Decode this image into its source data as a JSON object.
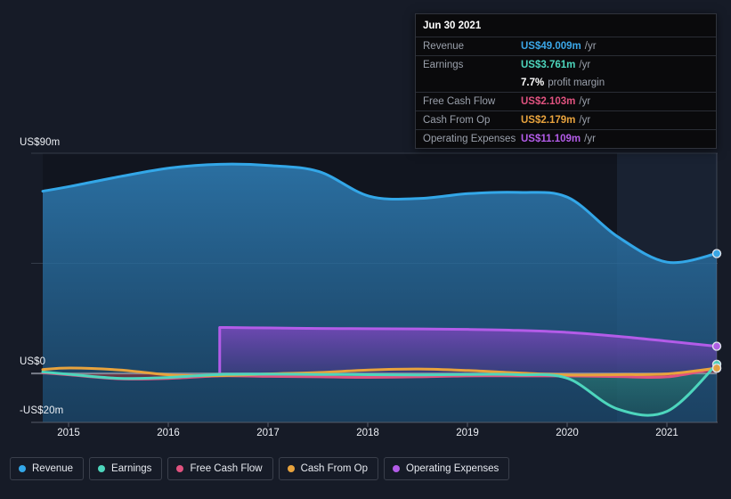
{
  "chart_data": {
    "type": "area",
    "title": "",
    "xlabel": "",
    "ylabel": "",
    "grid": true,
    "legend_position": "bottom",
    "ylim": [
      -20,
      90
    ],
    "y_ticks": [
      {
        "label": "US$90m",
        "value": 90
      },
      {
        "label": "US$0",
        "value": 0
      },
      {
        "label": "-US$20m",
        "value": -20
      }
    ],
    "x_ticks": [
      "2015",
      "2016",
      "2017",
      "2018",
      "2019",
      "2020",
      "2021"
    ],
    "x": [
      2014.72,
      2015,
      2015.5,
      2016,
      2016.5,
      2017,
      2017.5,
      2018,
      2018.5,
      2019,
      2019.5,
      2020,
      2020.5,
      2021,
      2021.5
    ],
    "series": [
      {
        "name": "Revenue",
        "color": "#33a7e8",
        "values": [
          74.5,
          76.5,
          80.5,
          84.0,
          85.5,
          85.0,
          82.5,
          72.5,
          71.5,
          73.5,
          74.0,
          72.0,
          56.0,
          45.5,
          49.009
        ]
      },
      {
        "name": "Earnings",
        "color": "#4dd6bd",
        "values": [
          0.6,
          -0.4,
          -2.0,
          -1.6,
          -0.4,
          -0.3,
          -0.4,
          -0.5,
          -0.6,
          -0.4,
          -0.5,
          -2.0,
          -14.5,
          -15.5,
          3.761
        ]
      },
      {
        "name": "Free Cash Flow",
        "color": "#e0527f",
        "values": [
          0.3,
          -0.6,
          -2.2,
          -2.0,
          -1.0,
          -1.2,
          -1.4,
          -1.6,
          -1.4,
          -1.0,
          -1.0,
          -1.0,
          -1.3,
          -1.4,
          2.103
        ]
      },
      {
        "name": "Cash From Op",
        "color": "#e8a33d",
        "values": [
          1.6,
          2.2,
          1.4,
          -0.6,
          -0.9,
          -0.2,
          0.4,
          1.4,
          1.8,
          1.2,
          0.2,
          -0.6,
          -0.5,
          -0.2,
          2.179
        ]
      },
      {
        "name": "Operating Expenses",
        "color": "#b35ce8",
        "start_x": 2016.5,
        "values": [
          null,
          null,
          null,
          null,
          18.8,
          18.6,
          18.4,
          18.3,
          18.2,
          18.0,
          17.6,
          16.8,
          15.2,
          13.2,
          11.109
        ]
      }
    ]
  },
  "tooltip": {
    "date": "Jun 30 2021",
    "rows": [
      {
        "label": "Revenue",
        "value": "US$49.009m",
        "unit": "/yr",
        "color": "#3ba7e8"
      },
      {
        "label": "Earnings",
        "value": "US$3.761m",
        "unit": "/yr",
        "color": "#4dd6bd"
      },
      {
        "label": "",
        "value": "7.7%",
        "unit": "profit margin",
        "color": "#ffffff",
        "sub": true
      },
      {
        "label": "Free Cash Flow",
        "value": "US$2.103m",
        "unit": "/yr",
        "color": "#e0527f"
      },
      {
        "label": "Cash From Op",
        "value": "US$2.179m",
        "unit": "/yr",
        "color": "#e8a33d"
      },
      {
        "label": "Operating Expenses",
        "value": "US$11.109m",
        "unit": "/yr",
        "color": "#b35ce8"
      }
    ]
  },
  "legend": {
    "items": [
      {
        "label": "Revenue",
        "color": "#33a7e8"
      },
      {
        "label": "Earnings",
        "color": "#4dd6bd"
      },
      {
        "label": "Free Cash Flow",
        "color": "#e0527f"
      },
      {
        "label": "Cash From Op",
        "color": "#e8a33d"
      },
      {
        "label": "Operating Expenses",
        "color": "#b35ce8"
      }
    ]
  },
  "colors": {
    "background": "#161b27",
    "plot_background": "#11151f",
    "gridline": "#3b4250",
    "zero_line": "#9aa0ab",
    "highlight_band": "#1b2536"
  }
}
